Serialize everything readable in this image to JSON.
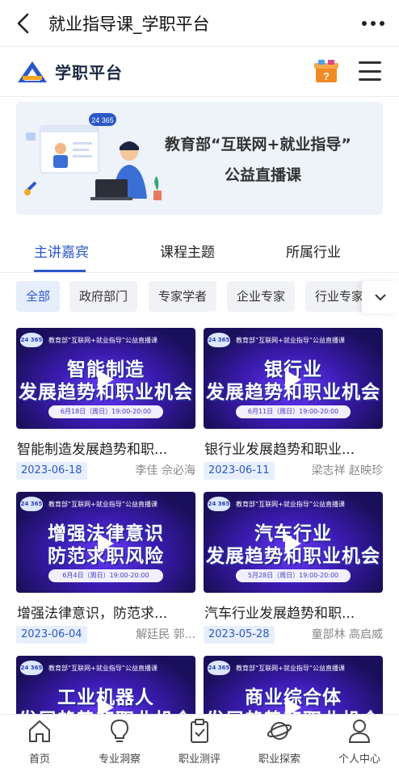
{
  "topbar": {
    "title": "就业指导课_学职平台"
  },
  "header": {
    "logo_text": "学职平台",
    "logo_icon": "logo-icon",
    "gift_icon": "mystery-box-icon",
    "menu_icon": "hamburger-icon"
  },
  "banner": {
    "tag": "24 365",
    "line1": "教育部“互联网+就业指导”",
    "line2": "公益直播课"
  },
  "tabs": [
    "主讲嘉宾",
    "课程主题",
    "所属行业"
  ],
  "filters": [
    "全部",
    "政府部门",
    "专家学者",
    "企业专家",
    "行业专家"
  ],
  "cards": [
    {
      "head": "教育部“互联网+就业指导”公益直播课",
      "badge": "24 365",
      "big1": "智能制造",
      "big2": "发展趋势和职业机会",
      "date_line": "6月18日（周日）19:00-20:00",
      "title": "智能制造发展趋势和职...",
      "date": "2023-06-18",
      "speakers": "李佳   佘必海"
    },
    {
      "head": "教育部“互联网+就业指导”公益直播课",
      "badge": "24 365",
      "big1": "银行业",
      "big2": "发展趋势和职业机会",
      "date_line": "6月11日（周日）19:00-20:00",
      "title": "银行业发展趋势和职业...",
      "date": "2023-06-11",
      "speakers": "梁志祥   赵映珍"
    },
    {
      "head": "教育部“互联网+就业指导”公益直播课",
      "badge": "24 365",
      "big1": "增强法律意识",
      "big2": "防范求职风险",
      "date_line": "6月4日（周日）19:00-20:00",
      "title": "增强法律意识，防范求...",
      "date": "2023-06-04",
      "speakers": "解廷民   郭..."
    },
    {
      "head": "教育部“互联网+就业指导”公益直播课",
      "badge": "24 365",
      "big1": "汽车行业",
      "big2": "发展趋势和职业机会",
      "date_line": "5月28日（周日）19:00-20:00",
      "title": "汽车行业发展趋势和职...",
      "date": "2023-05-28",
      "speakers": "童部林   高启威"
    },
    {
      "head": "教育部“互联网+就业指导”公益直播课",
      "badge": "24 365",
      "big1": "工业机器人",
      "big2": "发展趋势和职业机会",
      "date_line": "",
      "title": "",
      "date": "",
      "speakers": ""
    },
    {
      "head": "教育部“互联网+就业指导”公益直播课",
      "badge": "24 365",
      "big1": "商业综合体",
      "big2": "发展趋势和职业机会",
      "date_line": "",
      "title": "",
      "date": "",
      "speakers": ""
    }
  ],
  "bottom_nav": [
    {
      "label": "首页",
      "icon": "home-icon"
    },
    {
      "label": "专业洞察",
      "icon": "lightbulb-icon"
    },
    {
      "label": "职业测评",
      "icon": "clipboard-check-icon"
    },
    {
      "label": "职业探索",
      "icon": "planet-icon"
    },
    {
      "label": "个人中心",
      "icon": "person-icon"
    }
  ],
  "colors": {
    "accent": "#2a58c7",
    "chip_bg": "#f1f2f5",
    "thumb_purple": "#3a1bb0"
  }
}
